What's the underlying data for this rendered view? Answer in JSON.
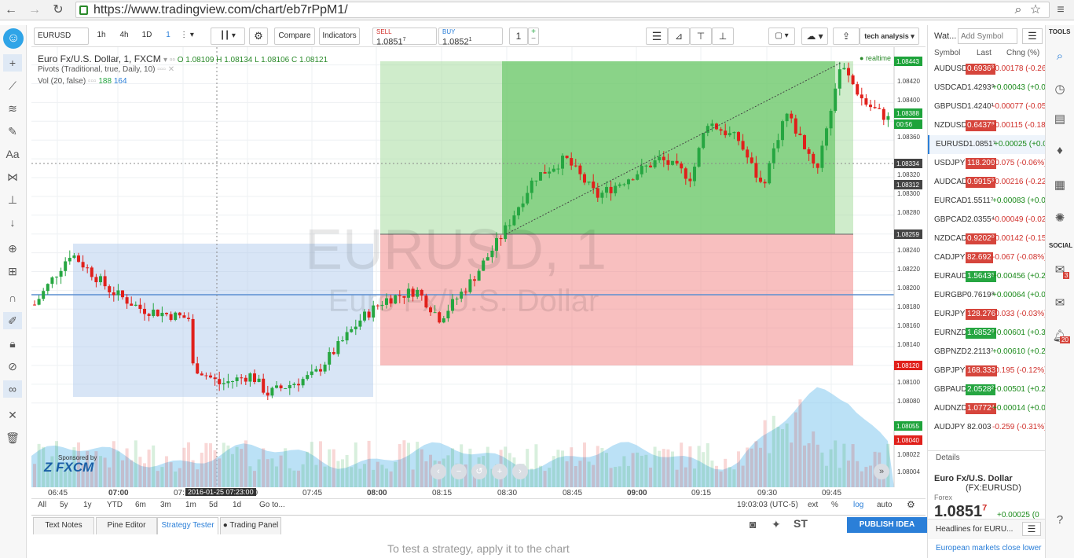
{
  "browser": {
    "url": "https://www.tradingview.com/chart/eb7rPpM1/"
  },
  "toolbar": {
    "symbol": "EURUSD",
    "intervals": [
      "1h",
      "4h",
      "1D",
      "1"
    ],
    "compare_label": "Compare",
    "indicators_label": "Indicators",
    "sell_label": "SELL",
    "sell_price": "1.0851",
    "sell_sup": "7",
    "buy_label": "BUY",
    "buy_price": "1.0852",
    "buy_sup": "1",
    "quantity": "1",
    "layout_label": "tech analysis"
  },
  "legend": {
    "title": "Euro Fx/U.S. Dollar, 1, FXCM",
    "ohlc": "O 1.08109 H 1.08134 L 1.08106 C 1.08121",
    "pivots": "Pivots (Traditional, true, Daily, 10)",
    "volume": "Vol (20, false)",
    "vol_a": "188",
    "vol_b": "164",
    "realtime": "realtime"
  },
  "watermark": {
    "symbol": "EURUSD, 1",
    "description": "Euro Fx/U.S. Dollar"
  },
  "sponsor": {
    "label": "Sponsored by",
    "brand": "FXCM"
  },
  "price_axis": {
    "labels": [
      "1.08420",
      "1.08400",
      "1.08360",
      "1.08320",
      "1.08300",
      "1.08280",
      "1.08240",
      "1.08220",
      "1.08200",
      "1.08180",
      "1.08160",
      "1.08140",
      "1.08100",
      "1.08080",
      "1.08022",
      "1.08004"
    ],
    "tags": [
      {
        "text": "1.08443",
        "color": "#1ea33b"
      },
      {
        "text": "1.08388",
        "color": "#1ea33b"
      },
      {
        "text": "00:56",
        "color": "#1ea33b"
      },
      {
        "text": "1.08334",
        "color": "#444444"
      },
      {
        "text": "1.08312",
        "color": "#444444"
      },
      {
        "text": "1.08259",
        "color": "#444444"
      },
      {
        "text": "1.08120",
        "color": "#e0201b"
      },
      {
        "text": "1.08055",
        "color": "#1ea33b"
      },
      {
        "text": "1.08040",
        "color": "#e0201b"
      }
    ]
  },
  "time_axis": {
    "labels": [
      "06:45",
      "07:00",
      "07:15",
      "07:30",
      "07:45",
      "08:00",
      "08:15",
      "08:30",
      "08:45",
      "09:00",
      "09:15",
      "09:30",
      "09:45"
    ],
    "crosshair": "2016-01-25 07:23:00"
  },
  "range_bar": {
    "ranges": [
      "All",
      "5y",
      "1y",
      "YTD",
      "6m",
      "3m",
      "1m",
      "5d",
      "1d"
    ],
    "goto": "Go to...",
    "clock": "19:03:03 (UTC-5)",
    "ext": "ext",
    "pct": "%",
    "log": "log",
    "auto": "auto"
  },
  "bottom_tabs": [
    "Text Notes",
    "Pine Editor",
    "Strategy Tester",
    "Trading Panel"
  ],
  "publish_label": "PUBLISH IDEA",
  "strategy_message": "To test a strategy, apply it to the chart",
  "watchlist": {
    "title": "Wat...",
    "add_placeholder": "Add Symbol",
    "col_symbol": "Symbol",
    "col_last": "Last",
    "col_chg": "Chng (%)",
    "rows": [
      {
        "symbol": "AUDUSD",
        "last": "0.6936³",
        "chg": "-0.00178 (-0.26",
        "dir": "dn",
        "bg": "dn"
      },
      {
        "symbol": "USDCAD",
        "last": "1.4293⁹",
        "chg": "+0.00043 (+0.0",
        "dir": "up",
        "bg": ""
      },
      {
        "symbol": "GBPUSD",
        "last": "1.4240¹",
        "chg": "-0.00077 (-0.05",
        "dir": "dn",
        "bg": ""
      },
      {
        "symbol": "NZDUSD",
        "last": "0.6437⁹",
        "chg": "-0.00115 (-0.18",
        "dir": "dn",
        "bg": "dn"
      },
      {
        "symbol": "EURUSD",
        "last": "1.0851⁷",
        "chg": "+0.00025 (+0.0",
        "dir": "up",
        "bg": ""
      },
      {
        "symbol": "USDJPY",
        "last": "118.209",
        "chg": "-0.075 (-0.06%)",
        "dir": "dn",
        "bg": "dn"
      },
      {
        "symbol": "AUDCAD",
        "last": "0.9915³",
        "chg": "-0.00216 (-0.22",
        "dir": "dn",
        "bg": "dn"
      },
      {
        "symbol": "EURCAD",
        "last": "1.5511⁷",
        "chg": "+0.00083 (+0.0",
        "dir": "up",
        "bg": ""
      },
      {
        "symbol": "GBPCAD",
        "last": "2.0355⁴",
        "chg": "-0.00049 (-0.02",
        "dir": "dn",
        "bg": ""
      },
      {
        "symbol": "NZDCAD",
        "last": "0.9202⁰",
        "chg": "-0.00142 (-0.15",
        "dir": "dn",
        "bg": "dn"
      },
      {
        "symbol": "CADJPY",
        "last": "82.692",
        "chg": "-0.067 (-0.08%)",
        "dir": "dn",
        "bg": "dn"
      },
      {
        "symbol": "EURAUD",
        "last": "1.5643⁵",
        "chg": "+0.00456 (+0.2",
        "dir": "up",
        "bg": "up"
      },
      {
        "symbol": "EURGBP",
        "last": "0.7619⁸",
        "chg": "+0.00064 (+0.0",
        "dir": "up",
        "bg": ""
      },
      {
        "symbol": "EURJPY",
        "last": "128.276",
        "chg": "-0.033 (-0.03%)",
        "dir": "dn",
        "bg": "dn"
      },
      {
        "symbol": "EURNZD",
        "last": "1.6852⁹",
        "chg": "+0.00601 (+0.3",
        "dir": "up",
        "bg": "up"
      },
      {
        "symbol": "GBPNZD",
        "last": "2.2113⁷",
        "chg": "+0.00610 (+0.2",
        "dir": "up",
        "bg": ""
      },
      {
        "symbol": "GBPJPY",
        "last": "168.333",
        "chg": "-0.195 (-0.12%)",
        "dir": "dn",
        "bg": "dn"
      },
      {
        "symbol": "GBPAUD",
        "last": "2.0528²",
        "chg": "+0.00501 (+0.2",
        "dir": "up",
        "bg": "up"
      },
      {
        "symbol": "AUDNZD",
        "last": "1.0772⁴",
        "chg": "+0.00014 (+0.0",
        "dir": "up",
        "bg": "dn"
      },
      {
        "symbol": "AUDJPY",
        "last": "82.003",
        "chg": "-0.259 (-0.31%)",
        "dir": "dn",
        "bg": ""
      }
    ],
    "details_label": "Details",
    "detail_name": "Euro Fx/U.S. Dollar",
    "detail_ticker": "(FX:EURUSD)",
    "detail_type": "Forex",
    "detail_price": "1.0851",
    "detail_sup": "7",
    "detail_chg": "+0.00025 (0",
    "headlines_label": "Headlines for EURU...",
    "headline_1": "European markets close lower"
  },
  "rail": {
    "tools_label": "TOOLS",
    "social_label": "SOCIAL",
    "badge_chat": "3",
    "badge_alerts": "20"
  },
  "colors": {
    "bull": "#26a641",
    "bear": "#e0201b",
    "accent": "#2b7fd8",
    "target": "#5bc35b",
    "stop": "#f28b8b",
    "range_box": "#a9c6ec"
  }
}
